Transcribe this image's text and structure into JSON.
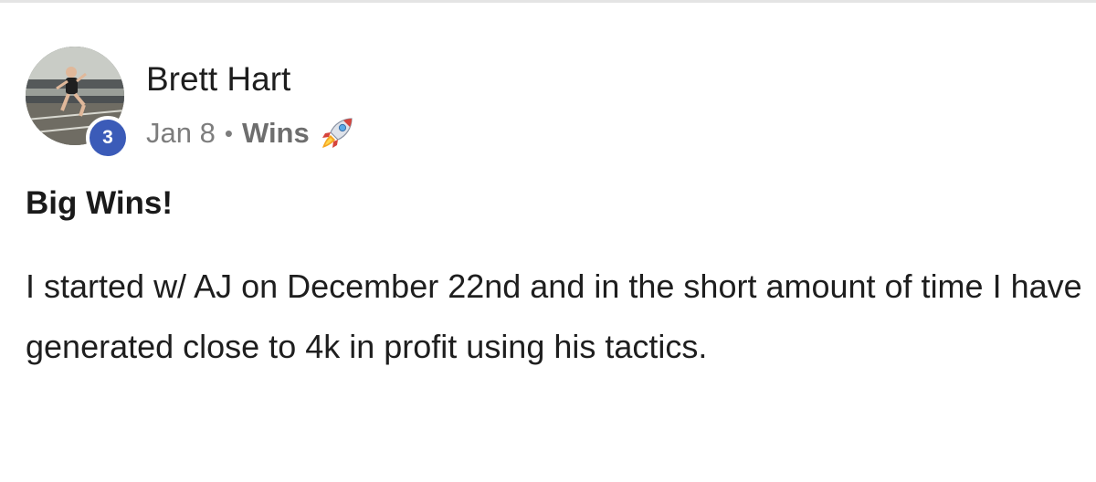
{
  "post": {
    "author": "Brett Hart",
    "level": "3",
    "date": "Jan 8",
    "separator": "•",
    "category": "Wins",
    "category_icon": "rocket-icon",
    "title": "Big Wins!",
    "body": "I started w/ AJ on December 22nd and in the short amount of time I have generated close to 4k in profit using his tactics."
  },
  "colors": {
    "badge": "#3b5bb8",
    "meta_text": "#7d7d7d",
    "body_text": "#1e1e1e",
    "divider": "#e4e4e4"
  }
}
